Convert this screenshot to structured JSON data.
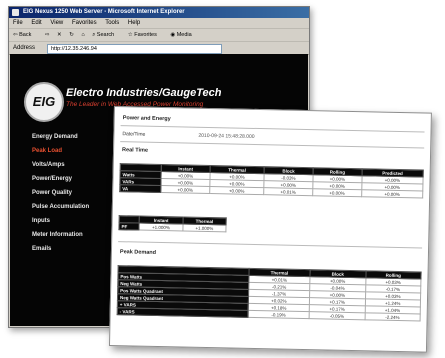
{
  "browser": {
    "title": "EIG Nexus 1250 Web Server - Microsoft Internet Explorer",
    "menu": [
      "File",
      "Edit",
      "View",
      "Favorites",
      "Tools",
      "Help"
    ],
    "toolbar": [
      "Back",
      "Search",
      "Favorites",
      "Media"
    ],
    "address_label": "Address",
    "address_value": "http://12.35.246.94"
  },
  "site": {
    "brand": "Electro Industries/GaugeTech",
    "tagline": "The Leader in Web Accessed Power Monitoring",
    "logo_text": "EIG"
  },
  "nav": [
    {
      "label": "Energy Demand",
      "active": false
    },
    {
      "label": "Peak Load",
      "active": true
    },
    {
      "label": "Volts/Amps",
      "active": false
    },
    {
      "label": "Power/Energy",
      "active": false
    },
    {
      "label": "Power Quality",
      "active": false
    },
    {
      "label": "Pulse Accumulation",
      "active": false
    },
    {
      "label": "Inputs",
      "active": false
    },
    {
      "label": "Meter Information",
      "active": false
    },
    {
      "label": "Emails",
      "active": false
    }
  ],
  "panel": {
    "section1": "Power and Energy",
    "date_label": "Date/Time",
    "date_value": "2010-09-24  15:48:28.000",
    "section2": "Real Time",
    "realtime": {
      "headers": [
        "",
        "Instant",
        "Thermal",
        "Block",
        "Rolling",
        "Predicted"
      ],
      "rows": [
        [
          "Watts",
          "+0.00%",
          "+0.00%",
          "-0.03%",
          "+0.00%",
          "+0.00%"
        ],
        [
          "VARs",
          "+0.00%",
          "+0.00%",
          "+0.00%",
          "+0.00%",
          "+0.00%"
        ],
        [
          "VA",
          "+0.00%",
          "+0.00%",
          "+0.01%",
          "+0.00%",
          "+0.00%"
        ]
      ]
    },
    "pf": {
      "headers": [
        "",
        "Instant",
        "Thermal"
      ],
      "rows": [
        [
          "PF",
          "+1.000%",
          "+1.000%"
        ]
      ]
    },
    "section3": "Peak Demand",
    "peak": {
      "headers": [
        "",
        "Thermal",
        "Block",
        "Rolling"
      ],
      "rows": [
        [
          "Pos Watts",
          "+0.01%",
          "+0.00%",
          "+0.03%"
        ],
        [
          "Neg Watts",
          "-0.21%",
          "-0.04%",
          "-0.17%"
        ],
        [
          "Pos Watts Quadrant",
          "-1.37%",
          "+0.00%",
          "+0.03%"
        ],
        [
          "Neg Watts Quadrant",
          "+0.02%",
          "+0.17%",
          "+1.24%"
        ],
        [
          "+ VARS",
          "+0.18%",
          "+0.17%",
          "+1.04%"
        ],
        [
          "- VARS",
          "-0.19%",
          "-0.05%",
          "-2.24%"
        ]
      ]
    }
  }
}
